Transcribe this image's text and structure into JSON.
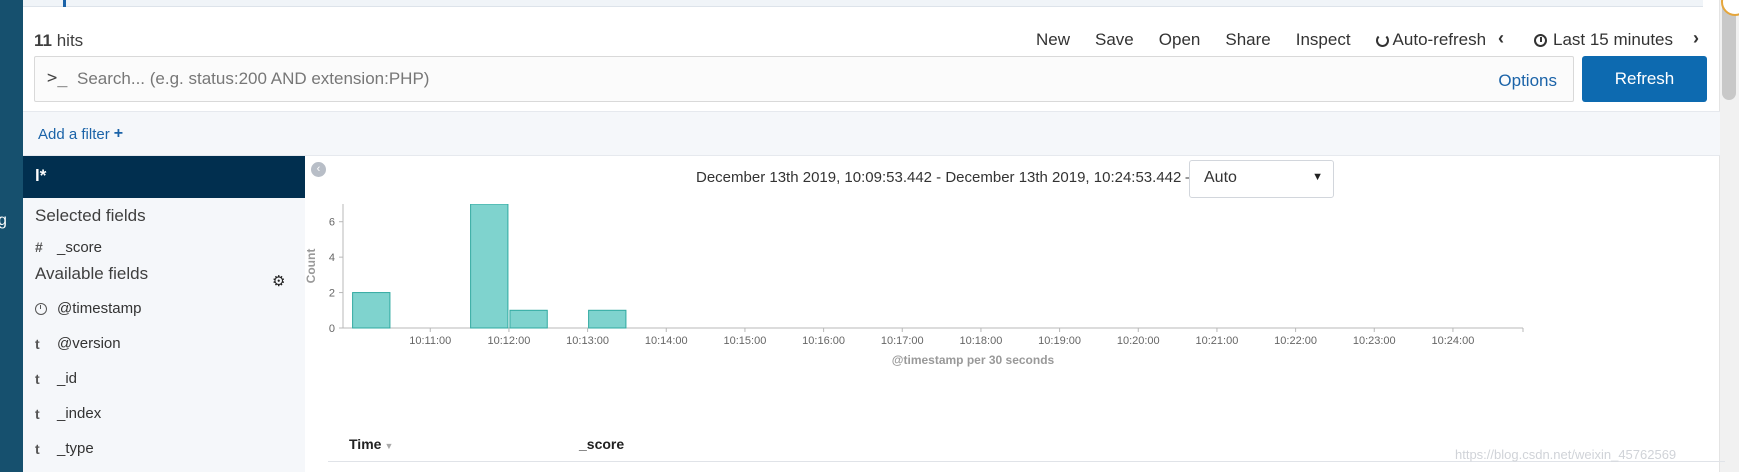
{
  "header": {
    "hits_count": "11",
    "hits_label": "hits",
    "nav": [
      "New",
      "Save",
      "Open",
      "Share",
      "Inspect"
    ],
    "auto_refresh": "Auto-refresh",
    "time_range": "Last 15 minutes"
  },
  "search": {
    "prompt": ">_",
    "placeholder": "Search... (e.g. status:200 AND extension:PHP)",
    "options": "Options",
    "refresh": "Refresh"
  },
  "filter": {
    "add_label": "Add a filter",
    "add_icon": "+"
  },
  "sidebar": {
    "index_pattern": "l*",
    "selected_title": "Selected fields",
    "selected_fields": [
      {
        "type": "#",
        "name": "_score"
      }
    ],
    "available_title": "Available fields",
    "available_fields": [
      {
        "type": "clock",
        "name": "@timestamp"
      },
      {
        "type": "t",
        "name": "@version"
      },
      {
        "type": "t",
        "name": "_id"
      },
      {
        "type": "t",
        "name": "_index"
      },
      {
        "type": "t",
        "name": "_type"
      }
    ]
  },
  "histogram": {
    "range_text": "December 13th 2019, 10:09:53.442 - December 13th 2019, 10:24:53.442 —",
    "interval": "Auto"
  },
  "chart_data": {
    "type": "bar",
    "title": "",
    "xlabel": "@timestamp per 30 seconds",
    "ylabel": "Count",
    "ylim": [
      0,
      7
    ],
    "yticks": [
      0,
      2,
      4,
      6
    ],
    "xticks": [
      "10:11:00",
      "10:12:00",
      "10:13:00",
      "10:14:00",
      "10:15:00",
      "10:16:00",
      "10:17:00",
      "10:18:00",
      "10:19:00",
      "10:20:00",
      "10:21:00",
      "10:22:00",
      "10:23:00",
      "10:24:00"
    ],
    "x_start": "10:09:53.442",
    "x_end": "10:24:53.442",
    "bars": [
      {
        "start": "10:10:00",
        "value": 2
      },
      {
        "start": "10:11:30",
        "value": 7
      },
      {
        "start": "10:12:00",
        "value": 1
      },
      {
        "start": "10:13:00",
        "value": 1
      }
    ],
    "bar_color": "#7fd3ce",
    "bar_stroke": "#2fa9a0",
    "grid": false
  },
  "table": {
    "columns": [
      "Time",
      "_score"
    ]
  },
  "watermark": "https://blog.csdn.net/weixin_45762569",
  "rail_char": "g"
}
